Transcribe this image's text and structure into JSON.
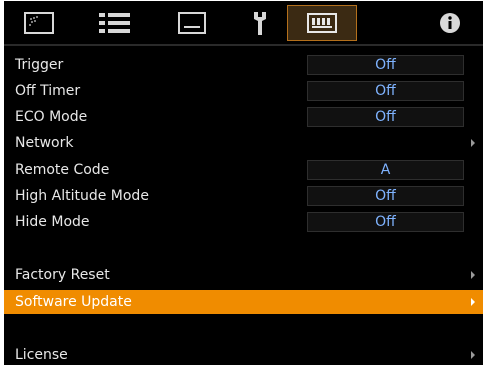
{
  "tabs": [
    {
      "icon": "picture-adjust-icon"
    },
    {
      "icon": "input-signal-icon"
    },
    {
      "icon": "display-setup-icon"
    },
    {
      "icon": "installation-wrench-icon"
    },
    {
      "icon": "function-connector-icon",
      "active": true
    },
    {
      "icon": "information-icon"
    }
  ],
  "rows": {
    "trigger": {
      "label": "Trigger",
      "value": "Off"
    },
    "off_timer": {
      "label": "Off Timer",
      "value": "Off"
    },
    "eco_mode": {
      "label": "ECO Mode",
      "value": "Off"
    },
    "network": {
      "label": "Network"
    },
    "remote_code": {
      "label": "Remote Code",
      "value": "A"
    },
    "high_altitude_mode": {
      "label": "High Altitude Mode",
      "value": "Off"
    },
    "hide_mode": {
      "label": "Hide Mode",
      "value": "Off"
    },
    "factory_reset": {
      "label": "Factory Reset"
    },
    "software_update": {
      "label": "Software Update",
      "selected": true
    },
    "license": {
      "label": "License"
    }
  },
  "colors": {
    "background": "#000000",
    "highlight": "#f08c00",
    "value_text": "#7fb3ff",
    "label_text": "#e8e8e8",
    "active_tab_border": "#b4701c"
  }
}
